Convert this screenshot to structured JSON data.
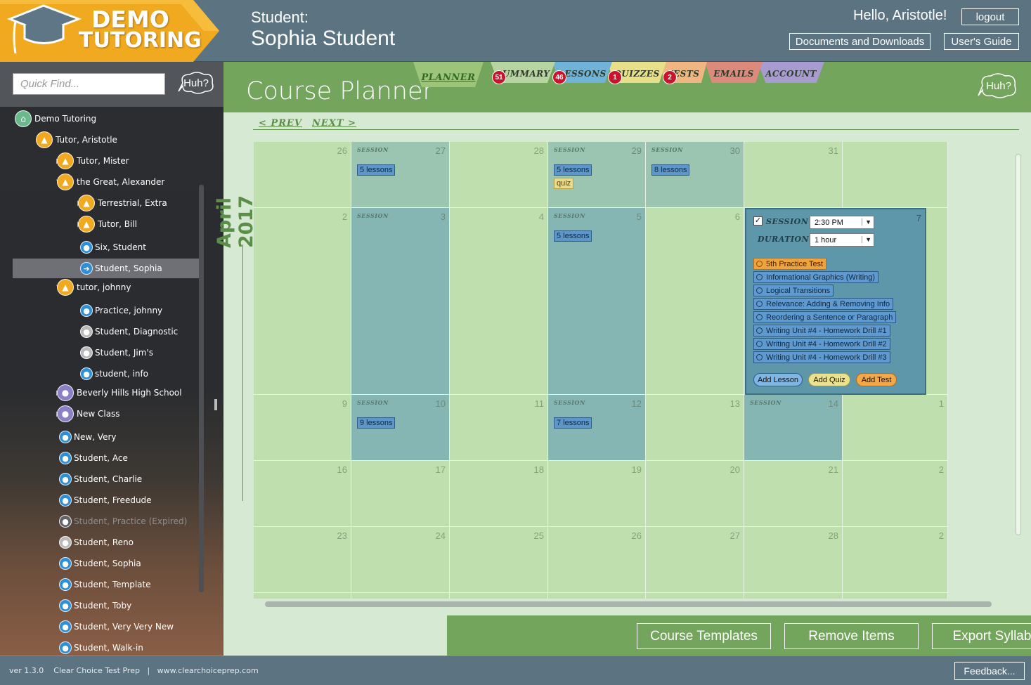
{
  "brand": {
    "line1": "DEMO",
    "line2": "TUTORING"
  },
  "header": {
    "student_label": "Student:",
    "student_name": "Sophia Student",
    "greeting": "Hello, Aristotle!",
    "logout": "logout",
    "documents": "Documents and Downloads",
    "guide": "User's Guide"
  },
  "sidebar": {
    "quick_find_placeholder": "Quick Find...",
    "huh": "Huh?",
    "tree": [
      {
        "label": "Demo Tutoring",
        "arrow": "down",
        "icon": "home-icon"
      },
      {
        "label": "Tutor, Aristotle",
        "arrow": "down",
        "icon": "tutor-icon"
      },
      {
        "label": "Tutor, Mister",
        "arrow": "right",
        "icon": "tutor-icon"
      },
      {
        "label": "the Great, Alexander",
        "arrow": "down",
        "icon": "tutor-icon"
      },
      {
        "label": "Terrestrial, Extra",
        "arrow": "right",
        "icon": "tutor-icon"
      },
      {
        "label": "Tutor, Bill",
        "arrow": "right",
        "icon": "tutor-icon"
      },
      {
        "label": "Six, Student",
        "arrow": "",
        "icon": "student-icon"
      },
      {
        "label": "Student, Sophia",
        "arrow": "",
        "icon": "arrow-right-icon",
        "selected": true
      },
      {
        "label": "tutor, johnny",
        "arrow": "down",
        "icon": "tutor-icon"
      },
      {
        "label": "Practice, johnny",
        "arrow": "",
        "icon": "student-icon"
      },
      {
        "label": "Student, Diagnostic",
        "arrow": "",
        "icon": "student-gray-icon"
      },
      {
        "label": "Student, Jim's",
        "arrow": "",
        "icon": "student-gray-icon"
      },
      {
        "label": "student, info",
        "arrow": "",
        "icon": "student-icon"
      },
      {
        "label": "Beverly Hills High School",
        "arrow": "right",
        "icon": "group-icon"
      },
      {
        "label": "New Class",
        "arrow": "right",
        "icon": "group-icon"
      },
      {
        "label": "New, Very",
        "arrow": "",
        "icon": "student-icon"
      },
      {
        "label": "Student, Ace",
        "arrow": "",
        "icon": "student-icon"
      },
      {
        "label": "Student, Charlie",
        "arrow": "",
        "icon": "student-icon"
      },
      {
        "label": "Student, Freedude",
        "arrow": "",
        "icon": "student-icon"
      },
      {
        "label": "Student, Practice  (Expired)",
        "arrow": "",
        "icon": "student-dim-icon",
        "expired": true
      },
      {
        "label": "Student, Reno",
        "arrow": "",
        "icon": "student-gray-icon"
      },
      {
        "label": "Student, Sophia",
        "arrow": "",
        "icon": "student-icon"
      },
      {
        "label": "Student, Template",
        "arrow": "",
        "icon": "student-icon"
      },
      {
        "label": "Student, Toby",
        "arrow": "",
        "icon": "student-icon"
      },
      {
        "label": "Student, Very Very New",
        "arrow": "",
        "icon": "student-icon"
      },
      {
        "label": "Student, Walk-in",
        "arrow": "",
        "icon": "student-icon"
      }
    ]
  },
  "main": {
    "title": "Course Planner",
    "huh": "Huh?",
    "tabs": [
      {
        "label": "PLANNER",
        "color": "#9cc57a",
        "badge": "51",
        "active": true
      },
      {
        "label": "SUMMARY",
        "color": "#b8d4a0",
        "badge": "46"
      },
      {
        "label": "LESSONS",
        "color": "#6fb3d9",
        "badge": "1"
      },
      {
        "label": "QUIZZES",
        "color": "#e9df88",
        "badge": "2"
      },
      {
        "label": "TESTS",
        "color": "#efb681",
        "badge": ""
      },
      {
        "label": "EMAILS",
        "color": "#dc8a7c",
        "badge": ""
      },
      {
        "label": "ACCOUNT",
        "color": "#a89bcf",
        "badge": ""
      }
    ],
    "prev": "< PREV",
    "next": "NEXT >",
    "month": "April 2017"
  },
  "calendar": {
    "session_label": "SESSION",
    "weeks": [
      [
        {
          "num": "26",
          "type": "n"
        },
        {
          "num": "27",
          "type": "s",
          "session": true,
          "chips": [
            {
              "t": "lesson",
              "label": "5 lessons"
            }
          ]
        },
        {
          "num": "28",
          "type": "n"
        },
        {
          "num": "29",
          "type": "s",
          "session": true,
          "chips": [
            {
              "t": "lesson",
              "label": "5 lessons"
            },
            {
              "t": "quiz",
              "label": "quiz"
            }
          ]
        },
        {
          "num": "30",
          "type": "s",
          "session": true,
          "chips": [
            {
              "t": "lesson",
              "label": "8 lessons"
            }
          ]
        },
        {
          "num": "31",
          "type": "n"
        },
        {
          "num": "",
          "type": "n"
        }
      ],
      [
        {
          "num": "2",
          "type": "n"
        },
        {
          "num": "3",
          "type": "d",
          "session": true,
          "chips": []
        },
        {
          "num": "4",
          "type": "n"
        },
        {
          "num": "5",
          "type": "d",
          "session": true,
          "chips": [
            {
              "t": "lesson",
              "label": "5 lessons"
            }
          ]
        },
        {
          "num": "6",
          "type": "n"
        },
        {
          "num": "7",
          "type": "n"
        },
        {
          "num": "",
          "type": "n"
        }
      ],
      [
        {
          "num": "9",
          "type": "n"
        },
        {
          "num": "10",
          "type": "d",
          "session": true,
          "chips": [
            {
              "t": "lesson",
              "label": "9 lessons"
            }
          ]
        },
        {
          "num": "11",
          "type": "n"
        },
        {
          "num": "12",
          "type": "d",
          "session": true,
          "chips": [
            {
              "t": "lesson",
              "label": "7 lessons"
            }
          ]
        },
        {
          "num": "13",
          "type": "n"
        },
        {
          "num": "14",
          "type": "d",
          "session": true,
          "chips": []
        },
        {
          "num": "1",
          "type": "n"
        }
      ],
      [
        {
          "num": "16",
          "type": "n"
        },
        {
          "num": "17",
          "type": "n"
        },
        {
          "num": "18",
          "type": "n"
        },
        {
          "num": "19",
          "type": "n"
        },
        {
          "num": "20",
          "type": "n"
        },
        {
          "num": "21",
          "type": "n"
        },
        {
          "num": "2",
          "type": "n"
        }
      ],
      [
        {
          "num": "23",
          "type": "n"
        },
        {
          "num": "24",
          "type": "n"
        },
        {
          "num": "25",
          "type": "n"
        },
        {
          "num": "26",
          "type": "n"
        },
        {
          "num": "27",
          "type": "n"
        },
        {
          "num": "28",
          "type": "n"
        },
        {
          "num": "2",
          "type": "n"
        }
      ],
      [
        {
          "num": "",
          "type": "n"
        },
        {
          "num": "",
          "type": "n"
        },
        {
          "num": "",
          "type": "n"
        },
        {
          "num": "",
          "type": "n"
        },
        {
          "num": "",
          "type": "n"
        },
        {
          "num": "",
          "type": "n"
        },
        {
          "num": "",
          "type": "n"
        }
      ]
    ]
  },
  "popup": {
    "day": "7",
    "session_checked": true,
    "session_label": "SESSION",
    "time": "2:30 PM",
    "duration_label": "DURATION",
    "duration": "1 hour",
    "items": [
      {
        "t": "test",
        "label": "5th Practice Test"
      },
      {
        "t": "lesson",
        "label": "Informational Graphics (Writing)"
      },
      {
        "t": "lesson",
        "label": "Logical Transitions"
      },
      {
        "t": "lesson",
        "label": "Relevance: Adding & Removing Info"
      },
      {
        "t": "lesson",
        "label": "Reordering a Sentence or Paragraph"
      },
      {
        "t": "lesson",
        "label": "Writing Unit #4 - Homework Drill #1"
      },
      {
        "t": "lesson",
        "label": "Writing Unit #4 - Homework Drill #2"
      },
      {
        "t": "lesson",
        "label": "Writing Unit #4 - Homework Drill #3"
      }
    ],
    "add_lesson": "Add Lesson",
    "add_quiz": "Add Quiz",
    "add_test": "Add Test"
  },
  "bottom": {
    "templates": "Course Templates",
    "remove": "Remove Items",
    "export": "Export Syllabus"
  },
  "footer": {
    "version": "ver 1.3.0",
    "company": "Clear Choice Test Prep",
    "sep": "|",
    "url": "www.clearchoiceprep.com",
    "feedback": "Feedback..."
  }
}
